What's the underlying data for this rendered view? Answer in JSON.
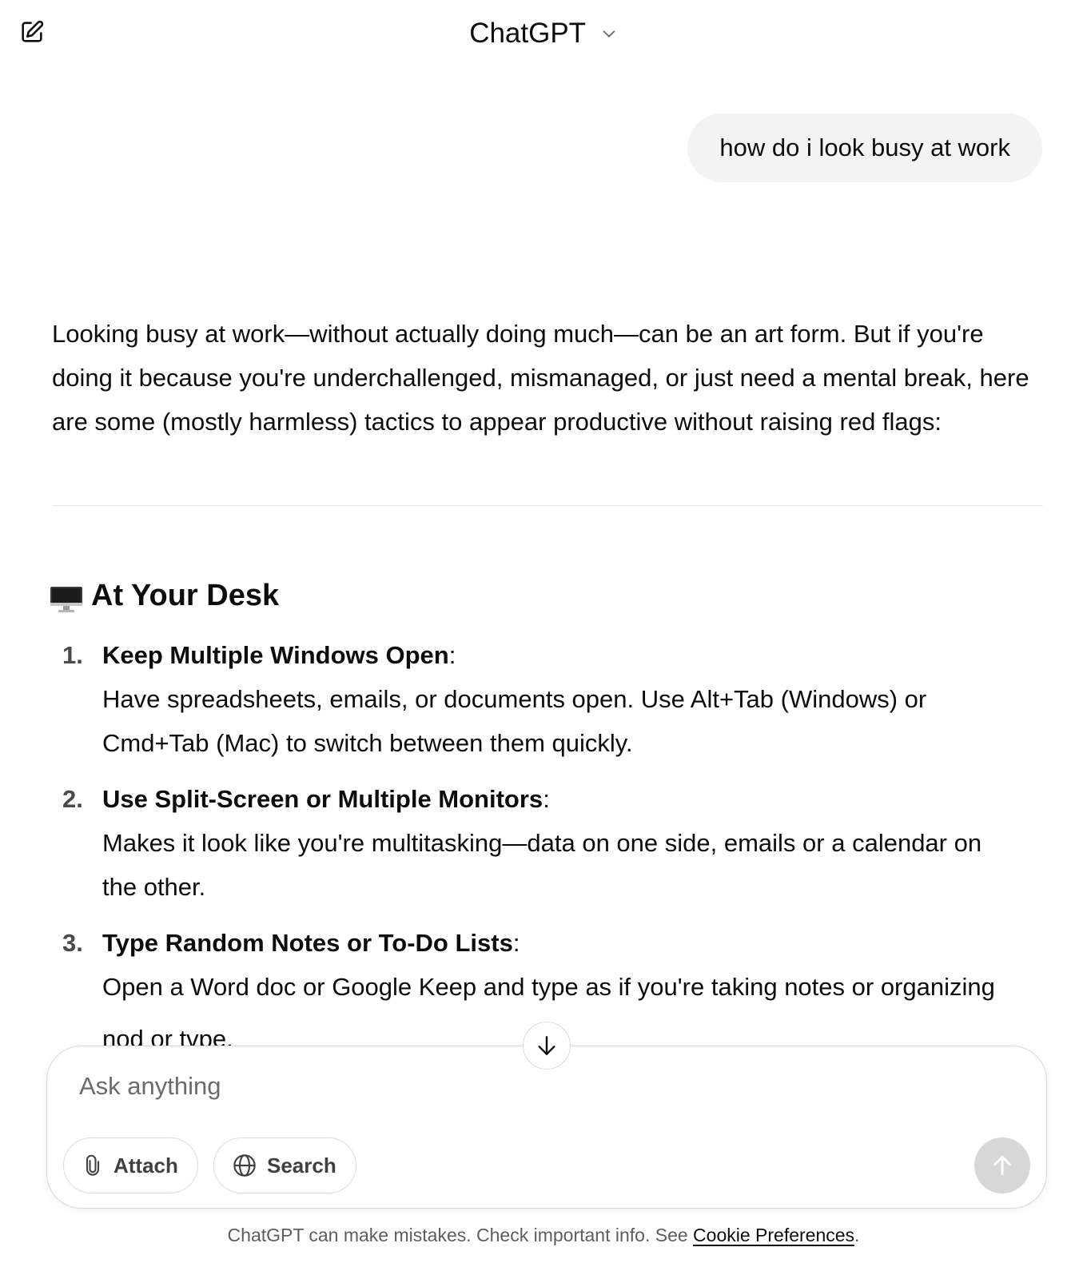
{
  "header": {
    "title": "ChatGPT",
    "new_chat_icon": "compose-icon",
    "model_menu_icon": "chevron-down-icon"
  },
  "conversation": {
    "user_message": "how do i look busy at work",
    "intro": "Looking busy at work—without actually doing much—can be an art form. But if you're doing it because you're underchallenged, mismanaged, or just need a mental break, here are some (mostly harmless) tactics to appear productive without raising red flags:",
    "section": {
      "emoji": "desktop-computer-icon",
      "heading": "At Your Desk"
    },
    "tips": [
      {
        "number": "1.",
        "title": "Keep Multiple Windows Open",
        "colon": ":",
        "body": "Have spreadsheets, emails, or documents open. Use Alt+Tab (Windows) or Cmd+Tab (Mac) to switch between them quickly."
      },
      {
        "number": "2.",
        "title": "Use Split-Screen or Multiple Monitors",
        "colon": ":",
        "body": "Makes it look like you're multitasking—data on one side, emails or a calendar on the other."
      },
      {
        "number": "3.",
        "title": "Type Random Notes or To-Do Lists",
        "colon": ":",
        "body": "Open a Word doc or Google Keep and type as if you're taking notes or organizing",
        "body_cut": "nod or tvpe."
      }
    ]
  },
  "composer": {
    "placeholder": "Ask anything",
    "attach_label": "Attach",
    "search_label": "Search",
    "send_icon": "arrow-up-icon",
    "scroll_icon": "arrow-down-icon"
  },
  "footer": {
    "text": "ChatGPT can make mistakes. Check important info. See ",
    "link": "Cookie Preferences",
    "end": "."
  },
  "colors": {
    "bubble": "#f3f3f3",
    "send_disabled": "#d7d7d7",
    "text": "#0d0d0d",
    "muted": "#5d5d5d"
  }
}
